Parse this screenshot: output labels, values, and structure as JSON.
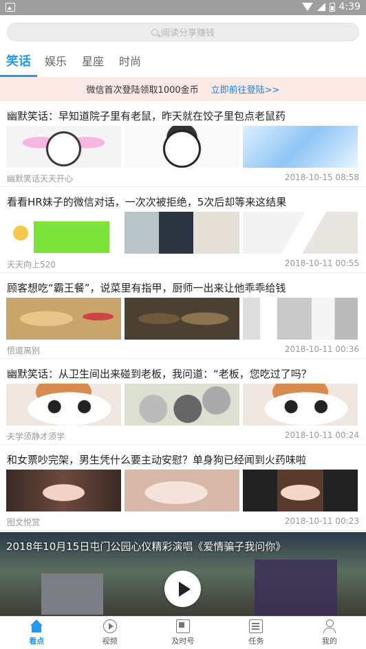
{
  "status_bar": {
    "time": "4:39"
  },
  "search": {
    "placeholder": "阅读分享赚钱"
  },
  "tabs": [
    {
      "label": "笑话",
      "active": true
    },
    {
      "label": "娱乐",
      "active": false
    },
    {
      "label": "星座",
      "active": false
    },
    {
      "label": "时尚",
      "active": false
    }
  ],
  "banner": {
    "message": "微信首次登陆领取1000金币",
    "cta": "立即前往登陆>>"
  },
  "articles": [
    {
      "title": "幽默笑话：早知道院子里有老鼠，昨天就在饺子里包点老鼠药",
      "source": "幽默笑话天天开心",
      "time": "2018-10-15 08:58"
    },
    {
      "title": "看看HR妹子的微信对话，一次次被拒绝，5次后却等来这结果",
      "source": "天天向上520",
      "time": "2018-10-11 00:55"
    },
    {
      "title": "顾客想吃“霸王餐”，说菜里有指甲，厨师一出来让他乖乖给钱",
      "source": "悟道离别",
      "time": "2018-10-11 00:36"
    },
    {
      "title": "幽默笑话：从卫生间出来碰到老板，我问道：“老板，您吃过了吗？",
      "source": "夫学须静才须学",
      "time": "2018-10-11 00:24"
    },
    {
      "title": "和女票吵完架，男生凭什么要主动安慰？单身狗已经闻到火药味啦",
      "source": "图文悦赏",
      "time": "2018-10-11 00:23"
    }
  ],
  "video": {
    "title": "2018年10月15日屯门公园心仪精彩演唱《爱情骗子我问你》"
  },
  "bottom_nav": [
    {
      "label": "看点",
      "icon": "home-icon",
      "active": true
    },
    {
      "label": "视频",
      "icon": "video-icon",
      "active": false
    },
    {
      "label": "及时号",
      "icon": "news-icon",
      "active": false
    },
    {
      "label": "任务",
      "icon": "task-icon",
      "active": false
    },
    {
      "label": "我的",
      "icon": "profile-icon",
      "active": false
    }
  ]
}
